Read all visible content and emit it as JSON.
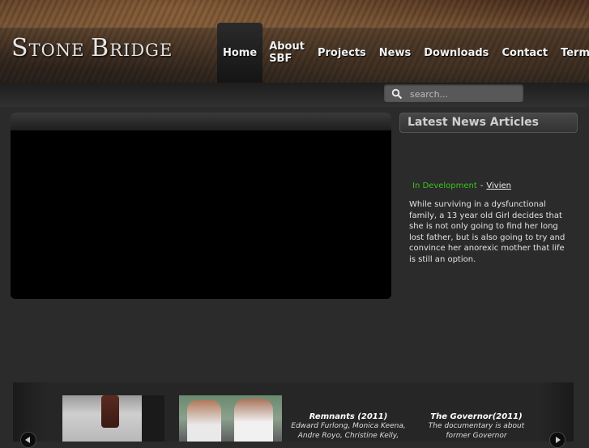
{
  "header": {
    "logo_text": "Stone Bridge",
    "logo_first": "S",
    "logo_rest1": "TONE ",
    "logo_b": "B",
    "logo_rest2": "RIDGE"
  },
  "nav": {
    "items": [
      {
        "label": "Home",
        "active": true
      },
      {
        "label": "About SBF"
      },
      {
        "label": "Projects"
      },
      {
        "label": "News"
      },
      {
        "label": "Downloads"
      },
      {
        "label": "Contact"
      },
      {
        "label": "Terms"
      }
    ]
  },
  "search": {
    "placeholder": "search...",
    "icon": "search-icon"
  },
  "news": {
    "heading": "Latest News Articles",
    "status": "In Development",
    "separator": "-",
    "title_link": "Vivien",
    "body": "While surviving in a dysfunctional family, a 13 year old Girl decides that she is not only going to find her long lost father, but is also going to try and convince her anorexic mother that life is still an option."
  },
  "carousel": {
    "promos": [
      {
        "title": "Remnants (2011)",
        "desc": "Edward Furlong, Monica Keena, Andre Royo, Christine Kelly,"
      },
      {
        "title": "The Governor(2011)",
        "desc": "The documentary is about former Governor"
      }
    ]
  },
  "colors": {
    "status_green": "#3ac21c",
    "background": "#2b2b2b"
  }
}
